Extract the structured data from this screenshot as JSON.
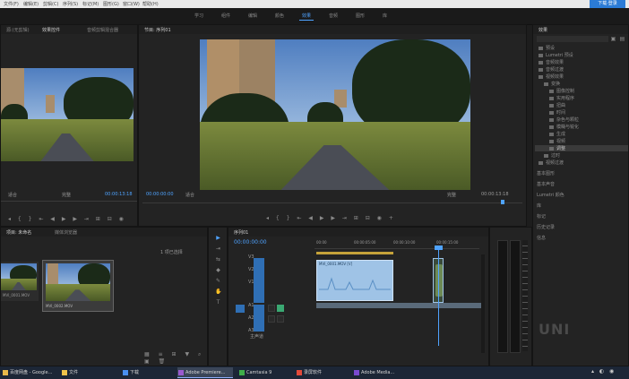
{
  "menubar": {
    "items": [
      "文件(F)",
      "编辑(E)",
      "剪辑(C)",
      "序列(S)",
      "标记(M)",
      "图形(G)",
      "窗口(W)",
      "帮助(H)"
    ],
    "login_button": "下载·登录"
  },
  "workspaces": [
    "学习",
    "组件",
    "编辑",
    "颜色",
    "效果",
    "音频",
    "图形",
    "库"
  ],
  "workspace_active_index": 4,
  "source_monitor": {
    "tabs": [
      "源:(无剪辑)",
      "效果控件",
      "音频剪辑混合器"
    ],
    "fit_label": "适合",
    "quality_label": "完整",
    "timecode_in": "00:00:00:00",
    "timecode_out": "00:00:13:18"
  },
  "program_monitor": {
    "tab": "节目: 序列01",
    "timecode": "00:00:00:00",
    "fit_label": "适合",
    "quality_label": "完整",
    "duration": "00:00:13:18"
  },
  "project_panel": {
    "tabs": [
      "项目: 未命名",
      "媒体浏览器"
    ],
    "search_label": "1 项已选择",
    "clips": [
      "MVI_0001.MOV",
      "MVI_0002.MOV"
    ]
  },
  "right_panel": {
    "title": "效果",
    "tree": [
      "预设",
      "Lumetri 预设",
      "音频效果",
      "音频过渡",
      "视频效果",
      "变换",
      "图像控制",
      "实用程序",
      "扭曲",
      "时间",
      "杂色与颗粒",
      "模糊与锐化",
      "生成",
      "视频",
      "调整",
      "过时",
      "视频过渡"
    ],
    "selected_index": 14,
    "sections": [
      "基本图形",
      "基本声音",
      "Lumetri 颜色",
      "库",
      "标记",
      "历史记录",
      "信息"
    ]
  },
  "timeline": {
    "tab": "序列01",
    "timecode": "00:00:00:00",
    "tracks": [
      "V3",
      "V2",
      "V1",
      "A1",
      "A2",
      "A3"
    ],
    "ruler": [
      "00:00",
      "00:00:05:00",
      "00:00:10:00",
      "00:00:15:00"
    ],
    "clip_label": "MVI_0001.MOV [V]",
    "master_label": "主声道"
  },
  "tools": [
    "▶",
    "⇥",
    "⇆",
    "◆",
    "✎",
    "✋",
    "T"
  ],
  "watermark": "UNI",
  "taskbar": {
    "items": [
      "百度网盘 - Google...",
      "文件",
      "下载",
      "Adobe Premiere...",
      "Camtasia 9",
      "录屏软件",
      "Adobe Media..."
    ],
    "active_index": 3
  },
  "colors": {
    "accent": "#4fa3ff",
    "panel": "#232323",
    "clip_video": "#9fc3e6",
    "track_target": "#2f6fb5"
  }
}
